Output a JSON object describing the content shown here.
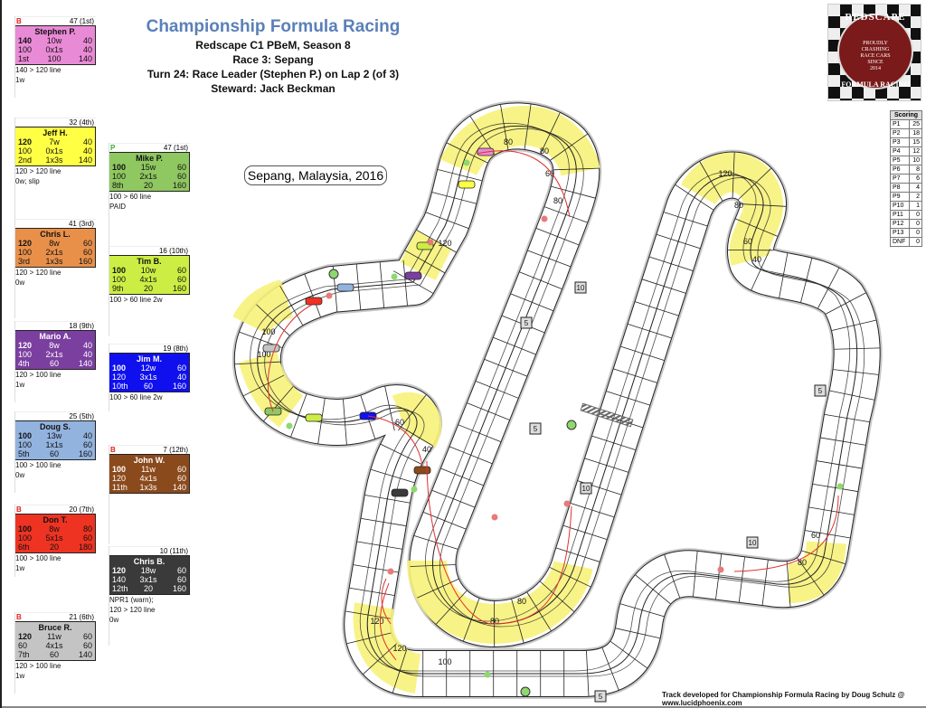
{
  "header": {
    "title": "Championship Formula Racing",
    "league": "Redscape C1 PBeM, Season 8",
    "race": "Race 3: Sepang",
    "turn": "Turn 24: Race Leader (Stephen P.) on Lap 2 (of 3)",
    "steward": "Steward: Jack Beckman"
  },
  "logo": {
    "top_text": "REDSCAPE",
    "motto": [
      "PROUDLY",
      "CRASHING",
      "RACE CARS",
      "SINCE",
      "2014"
    ],
    "bottom_text": "FORMULA RACING"
  },
  "location_label": "Sepang, Malaysia, 2016",
  "scoring": {
    "header": "Scoring",
    "rows": [
      {
        "pos": "P1",
        "pts": "25"
      },
      {
        "pos": "P2",
        "pts": "18"
      },
      {
        "pos": "P3",
        "pts": "15"
      },
      {
        "pos": "P4",
        "pts": "12"
      },
      {
        "pos": "P5",
        "pts": "10"
      },
      {
        "pos": "P6",
        "pts": "8"
      },
      {
        "pos": "P7",
        "pts": "6"
      },
      {
        "pos": "P8",
        "pts": "4"
      },
      {
        "pos": "P9",
        "pts": "2"
      },
      {
        "pos": "P10",
        "pts": "1"
      },
      {
        "pos": "P11",
        "pts": "0"
      },
      {
        "pos": "P12",
        "pts": "0"
      },
      {
        "pos": "P13",
        "pts": "0"
      },
      {
        "pos": "DNF",
        "pts": "0"
      }
    ]
  },
  "drivers": [
    {
      "flag": "B",
      "points": "47 (1st)",
      "name": "Stephen P.",
      "color": "#e98ad6",
      "text": "#111",
      "rows": [
        [
          "140",
          "10w",
          "40"
        ],
        [
          "100",
          "0x1s",
          "40"
        ],
        [
          "1st",
          "100",
          "140"
        ]
      ],
      "notes": [
        "140 > 120 line",
        "1w"
      ]
    },
    {
      "flag": "",
      "points": "32 (4th)",
      "name": "Jeff H.",
      "color": "#ffff44",
      "text": "#111",
      "rows": [
        [
          "120",
          "7w",
          "40"
        ],
        [
          "100",
          "0x1s",
          "40"
        ],
        [
          "2nd",
          "1x3s",
          "140"
        ]
      ],
      "notes": [
        "120 > 120 line",
        "0w; slip"
      ]
    },
    {
      "flag": "P",
      "points": "47 (1st)",
      "name": "Mike P.",
      "color": "#8fc760",
      "text": "#111",
      "rows": [
        [
          "100",
          "15w",
          "60"
        ],
        [
          "100",
          "2x1s",
          "60"
        ],
        [
          "8th",
          "20",
          "160"
        ]
      ],
      "notes": [
        "100 > 60 line",
        "PAID"
      ]
    },
    {
      "flag": "",
      "points": "41 (3rd)",
      "name": "Chris L.",
      "color": "#e8904a",
      "text": "#111",
      "rows": [
        [
          "120",
          "8w",
          "60"
        ],
        [
          "100",
          "2x1s",
          "60"
        ],
        [
          "3rd",
          "1x3s",
          "160"
        ]
      ],
      "notes": [
        "120 > 120 line",
        "0w"
      ]
    },
    {
      "flag": "",
      "points": "16 (10th)",
      "name": "Tim B.",
      "color": "#ccee44",
      "text": "#111",
      "rows": [
        [
          "100",
          "10w",
          "60"
        ],
        [
          "100",
          "4x1s",
          "60"
        ],
        [
          "9th",
          "20",
          "160"
        ]
      ],
      "notes": [
        "100 > 60 line 2w"
      ]
    },
    {
      "flag": "",
      "points": "18 (9th)",
      "name": "Mario A.",
      "color": "#7b3fa0",
      "text": "#fff",
      "rows": [
        [
          "120",
          "8w",
          "40"
        ],
        [
          "100",
          "2x1s",
          "40"
        ],
        [
          "4th",
          "60",
          "140"
        ]
      ],
      "notes": [
        "120 > 100 line",
        "1w"
      ]
    },
    {
      "flag": "",
      "points": "19 (8th)",
      "name": "Jim M.",
      "color": "#1010ee",
      "text": "#fff",
      "rows": [
        [
          "100",
          "12w",
          "60"
        ],
        [
          "120",
          "3x1s",
          "40"
        ],
        [
          "10th",
          "60",
          "160"
        ]
      ],
      "notes": [
        "100 > 60 line 2w"
      ]
    },
    {
      "flag": "",
      "points": "25 (5th)",
      "name": "Doug S.",
      "color": "#93b3df",
      "text": "#111",
      "rows": [
        [
          "100",
          "13w",
          "40"
        ],
        [
          "100",
          "1x1s",
          "60"
        ],
        [
          "5th",
          "60",
          "160"
        ]
      ],
      "notes": [
        "100 > 100 line",
        "0w"
      ]
    },
    {
      "flag": "B",
      "points": "7 (12th)",
      "name": "John W.",
      "color": "#8b4a1c",
      "text": "#fff",
      "rows": [
        [
          "100",
          "11w",
          "60"
        ],
        [
          "120",
          "4x1s",
          "60"
        ],
        [
          "11th",
          "1x3s",
          "140"
        ]
      ],
      "notes": []
    },
    {
      "flag": "B",
      "points": "20 (7th)",
      "name": "Don T.",
      "color": "#ee3322",
      "text": "#111",
      "rows": [
        [
          "100",
          "8w",
          "80"
        ],
        [
          "100",
          "5x1s",
          "60"
        ],
        [
          "6th",
          "20",
          "180"
        ]
      ],
      "notes": [
        "100 > 100 line",
        "1w"
      ]
    },
    {
      "flag": "",
      "points": "10 (11th)",
      "name": "Chris B.",
      "color": "#3a3a3a",
      "text": "#fff",
      "rows": [
        [
          "120",
          "18w",
          "60"
        ],
        [
          "140",
          "3x1s",
          "60"
        ],
        [
          "12th",
          "20",
          "160"
        ]
      ],
      "notes": [
        "NPR1  (warn);",
        "120 > 120 line",
        "0w"
      ]
    },
    {
      "flag": "B",
      "points": "21 (6th)",
      "name": "Bruce R.",
      "color": "#c4c4c4",
      "text": "#111",
      "rows": [
        [
          "120",
          "11w",
          "60"
        ],
        [
          "60",
          "4x1s",
          "60"
        ],
        [
          "7th",
          "60",
          "140"
        ]
      ],
      "notes": [
        "120 > 100 line",
        "1w"
      ]
    }
  ],
  "track": {
    "corner_speeds": [
      "80",
      "60",
      "120",
      "100",
      "40"
    ],
    "distance_markers": [
      "10",
      "5",
      "5",
      "10",
      "5",
      "10",
      "5"
    ]
  },
  "footer": "Track developed for Championship Formula Racing by Doug Schulz @ www.lucidphoenix.com"
}
